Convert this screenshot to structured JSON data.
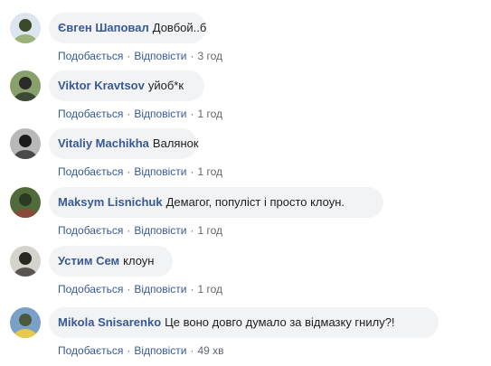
{
  "comments": [
    {
      "author": "Євген Шаповал",
      "text": "Довбой..б",
      "like": "Подобається",
      "reply": "Відповісти",
      "time": "3 год",
      "avatar_colors": [
        "#dde6ef",
        "#9bb27a",
        "#3b4a2a"
      ]
    },
    {
      "author": "Viktor Kravtsov",
      "text": "уйоб*к",
      "like": "Подобається",
      "reply": "Відповісти",
      "time": "1 год",
      "avatar_colors": [
        "#8aa06a",
        "#3d4a33",
        "#2a2a2a"
      ]
    },
    {
      "author": "Vitaliy Machikha",
      "text": "Валянок",
      "like": "Подобається",
      "reply": "Відповісти",
      "time": "1 год",
      "avatar_colors": [
        "#b8b8b8",
        "#4a4a4a",
        "#1c1c1c"
      ]
    },
    {
      "author": "Maksym Lisnichuk",
      "text": "Демагог, популіст і просто клоун.",
      "like": "Подобається",
      "reply": "Відповісти",
      "time": "1 год",
      "avatar_colors": [
        "#4f6b3a",
        "#8a4a3a",
        "#2c3a24"
      ]
    },
    {
      "author": "Устим Сем",
      "text": "клоун",
      "like": "Подобається",
      "reply": "Відповісти",
      "time": "1 год",
      "avatar_colors": [
        "#d6d2cc",
        "#5a5450",
        "#2a2622"
      ]
    },
    {
      "author": "Mikola Snisarenko",
      "text": "Це воно довго думало за відмазку гнилу?!",
      "like": "Подобається",
      "reply": "Відповісти",
      "time": "49 хв",
      "avatar_colors": [
        "#7aa0c8",
        "#e8c84a",
        "#4a5a3a"
      ]
    }
  ],
  "separator": "·"
}
